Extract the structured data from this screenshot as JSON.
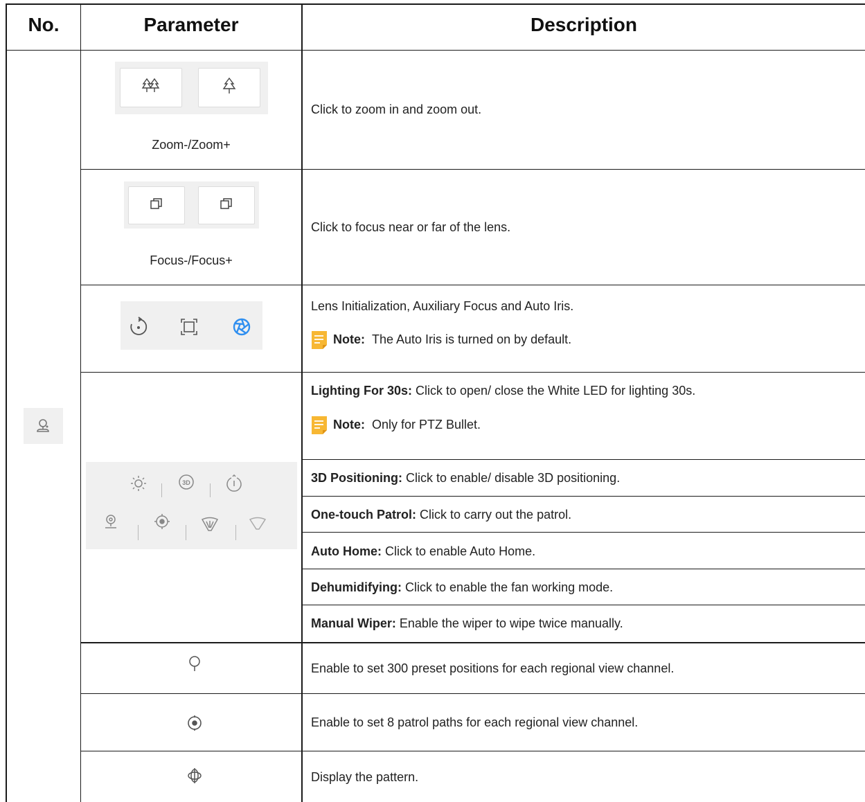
{
  "header": {
    "col_no": "No.",
    "col_param": "Parameter",
    "col_desc": "Description"
  },
  "rows": {
    "zoom": {
      "caption": "Zoom-/Zoom+",
      "desc": "Click to zoom in and zoom out."
    },
    "focus": {
      "caption": "Focus-/Focus+",
      "desc": "Click to focus near or far of the lens."
    },
    "lens": {
      "desc": "Lens Initialization, Auxiliary Focus and Auto Iris.",
      "note_label": "Note:",
      "note_text": "The Auto Iris is turned on by default."
    },
    "features": [
      {
        "label": "Lighting For 30s:",
        "text": "Click to open/ close the White LED for lighting 30s."
      },
      {
        "label": "3D Positioning:",
        "text": "Click to enable/ disable 3D positioning."
      },
      {
        "label": "One-touch Patrol:",
        "text": "Click to carry out the patrol."
      },
      {
        "label": "Auto Home:",
        "text": "Click to enable Auto Home."
      },
      {
        "label": "Dehumidifying:",
        "text": "Click to enable the fan working mode."
      },
      {
        "label": "Manual Wiper:",
        "text": "Enable the wiper to wipe twice manually."
      }
    ],
    "lighting_note": {
      "label": "Note:",
      "text": "Only for PTZ Bullet."
    },
    "preset": {
      "desc": "Enable to set 300 preset positions for each regional view channel."
    },
    "patrol": {
      "desc": "Enable to set 8 patrol paths for each regional view channel."
    },
    "pattern": {
      "desc": "Display the pattern."
    }
  },
  "icons": {
    "ptz": "ptz-control-icon",
    "zoom_out": "zoom-out-trees-icon",
    "zoom_in": "zoom-in-tree-icon",
    "focus_near": "focus-near-icon",
    "focus_far": "focus-far-icon",
    "lens_init": "lens-initialization-icon",
    "aux_focus": "auxiliary-focus-icon",
    "auto_iris": "auto-iris-icon",
    "preset": "preset-icon",
    "patrol": "patrol-icon",
    "pattern": "pattern-icon"
  },
  "colors": {
    "accent_blue": "#2f8ff0",
    "note_yellow": "#f7b733",
    "grid_line": "#1a1a1a",
    "panel_bg": "#f0f0f0"
  }
}
